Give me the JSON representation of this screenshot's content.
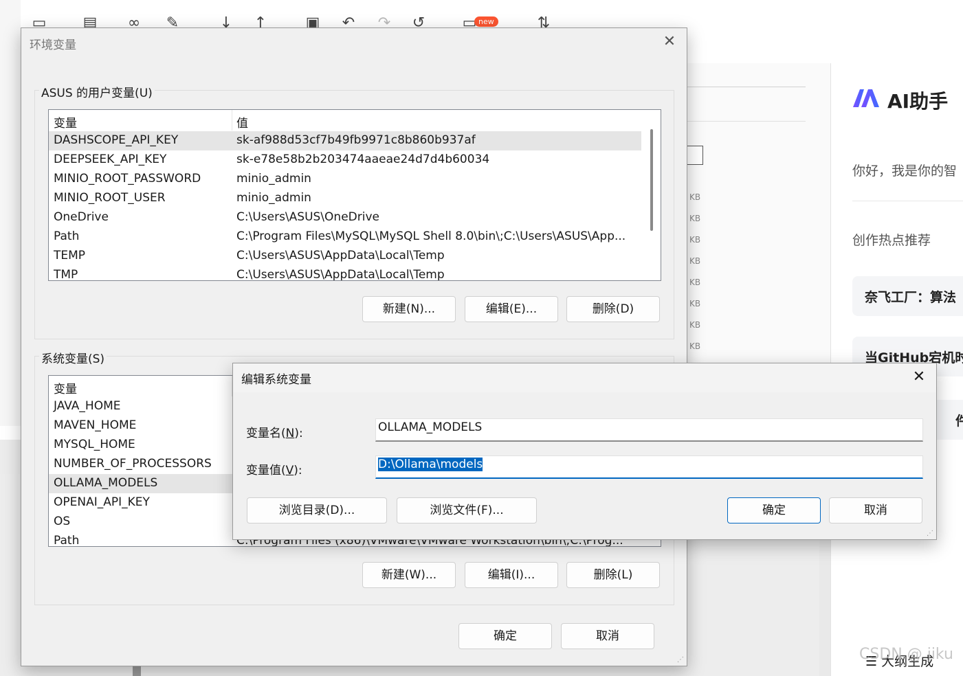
{
  "background_app": {
    "toolbar_icons": [
      "file-icon",
      "save-icon",
      "link-icon",
      "pen-icon",
      "download-icon",
      "upload-icon",
      "floppy-icon",
      "undo-icon",
      "redo-icon",
      "history-icon",
      "template-icon",
      "sort-icon"
    ],
    "new_badge": "new",
    "kb_labels": [
      "KB",
      "KB",
      "KB",
      "KB",
      "KB",
      "KB",
      "KB",
      "KB"
    ],
    "ai_panel": {
      "title": "AI助手",
      "greeting": "你好，我是你的智",
      "hot_label": "创作热点推荐",
      "cards": [
        "奈飞工厂：算法",
        "当GitHub宕机时",
        "件开"
      ],
      "bottom_action": "☰ 大纲生成"
    },
    "watermark": "CSDN @ jiku"
  },
  "env_dialog": {
    "title": "环境变量",
    "user_group_label": "ASUS 的用户变量(U)",
    "system_group_label": "系统变量(S)",
    "col_variable": "变量",
    "col_value": "值",
    "user_vars": [
      {
        "name": "DASHSCOPE_API_KEY",
        "value": "sk-af988d53cf7b49fb9971c8b860b937af"
      },
      {
        "name": "DEEPSEEK_API_KEY",
        "value": "sk-e78e58b2b203474aaeae24d7d4b60034"
      },
      {
        "name": "MINIO_ROOT_PASSWORD",
        "value": "minio_admin"
      },
      {
        "name": "MINIO_ROOT_USER",
        "value": "minio_admin"
      },
      {
        "name": "OneDrive",
        "value": "C:\\Users\\ASUS\\OneDrive"
      },
      {
        "name": "Path",
        "value": "C:\\Program Files\\MySQL\\MySQL Shell 8.0\\bin\\;C:\\Users\\ASUS\\App..."
      },
      {
        "name": "TEMP",
        "value": "C:\\Users\\ASUS\\AppData\\Local\\Temp"
      },
      {
        "name": "TMP",
        "value": "C:\\Users\\ASUS\\AppData\\Local\\Temp"
      }
    ],
    "system_vars": [
      {
        "name": "JAVA_HOME",
        "value": ""
      },
      {
        "name": "MAVEN_HOME",
        "value": ""
      },
      {
        "name": "MYSQL_HOME",
        "value": ""
      },
      {
        "name": "NUMBER_OF_PROCESSORS",
        "value": ""
      },
      {
        "name": "OLLAMA_MODELS",
        "value": ""
      },
      {
        "name": "OPENAI_API_KEY",
        "value": ""
      },
      {
        "name": "OS",
        "value": ""
      },
      {
        "name": "Path",
        "value": "C:\\Program Files (x86)\\VMware\\VMware Workstation\\bin\\;C:\\Prog..."
      }
    ],
    "user_buttons": {
      "new": "新建(N)...",
      "edit": "编辑(E)...",
      "delete": "删除(D)"
    },
    "system_buttons": {
      "new": "新建(W)...",
      "edit": "编辑(I)...",
      "delete": "删除(L)"
    },
    "ok": "确定",
    "cancel": "取消"
  },
  "edit_dialog": {
    "title": "编辑系统变量",
    "name_label_pre": "变量名(",
    "name_label_key": "N",
    "name_label_post": "):",
    "value_label_pre": "变量值(",
    "value_label_key": "V",
    "value_label_post": "):",
    "name_value": "OLLAMA_MODELS",
    "value_value": "D:\\Ollama\\models",
    "browse_dir": "浏览目录(D)...",
    "browse_file": "浏览文件(F)...",
    "ok": "确定",
    "cancel": "取消"
  }
}
